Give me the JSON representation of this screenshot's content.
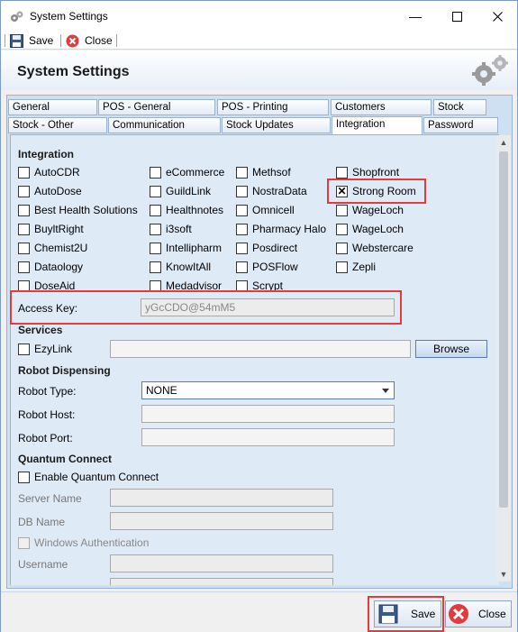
{
  "window": {
    "title": "System Settings"
  },
  "toolbar": {
    "save_label": "Save",
    "close_label": "Close"
  },
  "header": {
    "title": "System Settings"
  },
  "tabs": {
    "row1": [
      "General",
      "POS - General",
      "POS - Printing",
      "Customers",
      "Stock"
    ],
    "row2": [
      "Stock - Other",
      "Communication",
      "Stock Updates",
      "Integration",
      "Password"
    ],
    "active": "Integration"
  },
  "integration": {
    "heading": "Integration",
    "col1": [
      "AutoCDR",
      "AutoDose",
      "Best Health Solutions",
      "BuyltRight",
      "Chemist2U",
      "Dataology",
      "DoseAid"
    ],
    "col2": [
      "eCommerce",
      "GuildLink",
      "Healthnotes",
      "i3soft",
      "Intellipharm",
      "KnowItAll",
      "Medadvisor"
    ],
    "col3": [
      "Methsof",
      "NostraData",
      "Omnicell",
      "Pharmacy Halo",
      "Posdirect",
      "POSFlow",
      "Scrypt"
    ],
    "col4": [
      "Shopfront",
      "Strong Room",
      "WageLoch",
      "WageLoch",
      "Webstercare",
      "Zepli"
    ],
    "checked": "Strong Room",
    "access_key_label": "Access Key:",
    "access_key_value": "yGcCDO@54mM5"
  },
  "services": {
    "heading": "Services",
    "ezylink_label": "EzyLink",
    "browse_label": "Browse"
  },
  "robot": {
    "heading": "Robot Dispensing",
    "type_label": "Robot Type:",
    "type_value": "NONE",
    "host_label": "Robot Host:",
    "port_label": "Robot Port:"
  },
  "quantum": {
    "heading": "Quantum Connect",
    "enable_label": "Enable Quantum Connect",
    "server_label": "Server Name",
    "db_label": "DB Name",
    "windows_auth_label": "Windows Authentication",
    "username_label": "Username"
  },
  "footer": {
    "save_label": "Save",
    "close_label": "Close"
  },
  "colors": {
    "highlight": "#e5393a",
    "panel": "#dfeaf7",
    "tab_bg": "#cfe0f3"
  }
}
